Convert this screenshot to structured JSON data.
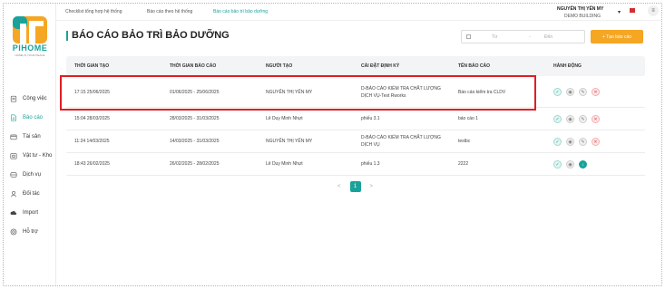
{
  "topbar": {
    "tabs": [
      {
        "label": "Checklist tổng hợp hệ thống"
      },
      {
        "label": "Báo cáo theo hệ thống"
      },
      {
        "label": "Báo cáo bảo trì bảo dưỡng"
      }
    ],
    "user_name": "NGUYỄN THỊ YẾN MY",
    "building": "DEMO BUILDING"
  },
  "logo": {
    "text": "PIHOME",
    "sub": "HOME IS YOUR PEACE"
  },
  "sidebar": {
    "items": [
      {
        "label": "Công việc"
      },
      {
        "label": "Báo cáo"
      },
      {
        "label": "Tài sản"
      },
      {
        "label": "Vật tư - Kho"
      },
      {
        "label": "Dịch vụ"
      },
      {
        "label": "Đối tác"
      },
      {
        "label": "Import"
      },
      {
        "label": "Hỗ trợ"
      }
    ]
  },
  "main": {
    "title": "BÁO CÁO BẢO TRÌ BẢO DƯỠNG",
    "date_from_placeholder": "Từ",
    "date_sep": "-",
    "date_to_placeholder": "Đến",
    "add_button": "+ Tạo báo cáo"
  },
  "table": {
    "headers": [
      "THỜI GIAN TẠO",
      "THỜI GIAN BÁO CÁO",
      "NGƯỜI TẠO",
      "CÀI ĐẶT ĐỊNH KỲ",
      "TÊN BÁO CÁO",
      "HÀNH ĐỘNG"
    ],
    "rows": [
      {
        "created": "17:15 25/06/2025",
        "period": "01/06/2025 - 25/06/2025",
        "creator": "NGUYỄN THỊ YẾN MY",
        "schedule": "D-BÁO CÁO KIỂM TRA CHẤT LƯỢNG DỊCH VỤ-Test Rworks",
        "name": "Báo cáo kiểm tra CLDV"
      },
      {
        "created": "15:04 28/03/2025",
        "period": "28/03/2025 - 31/03/2025",
        "creator": "Lê Duy Minh Nhựt",
        "schedule": "phiếu 3.1",
        "name": "báo cáo 1"
      },
      {
        "created": "11:24 14/03/2025",
        "period": "14/03/2025 - 31/03/2025",
        "creator": "NGUYỄN THỊ YẾN MY",
        "schedule": "D-BÁO CÁO KIỂM TRA CHẤT LƯỢNG DỊCH VỤ",
        "name": "testbc"
      },
      {
        "created": "18:43 26/02/2025",
        "period": "26/02/2025 - 28/02/2025",
        "creator": "Lê Duy Minh Nhựt",
        "schedule": "phiếu 1.3",
        "name": "2222"
      }
    ]
  },
  "pagination": {
    "prev": "<",
    "current": "1",
    "next": ">"
  },
  "colors": {
    "accent": "#1aa29a",
    "add_button": "#f5a623",
    "highlight": "#e11d24"
  }
}
